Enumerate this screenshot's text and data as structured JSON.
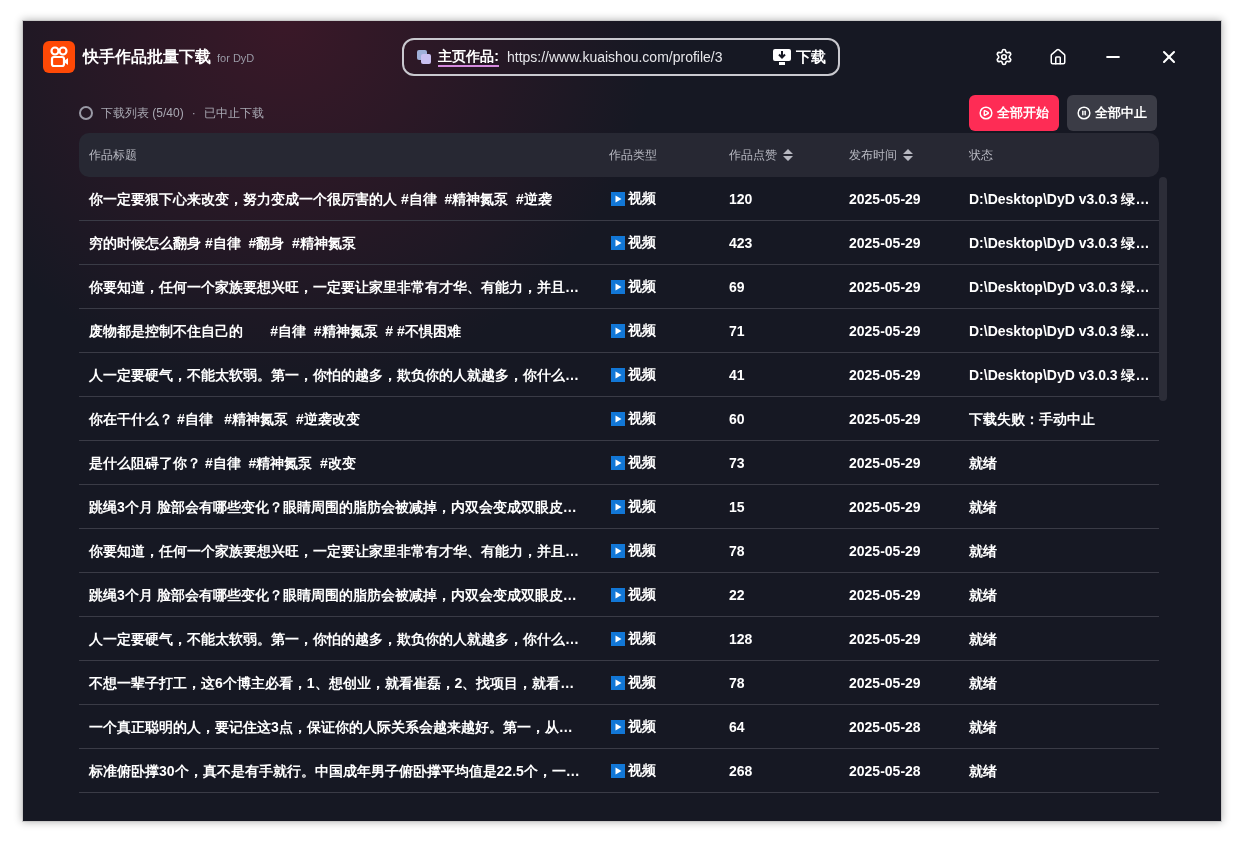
{
  "app": {
    "title": "快手作品批量下载",
    "subtitle": "for DyD"
  },
  "url_bar": {
    "label": "主页作品:",
    "value": "https://www.kuaishou.com/profile/3",
    "button": "下载"
  },
  "list_status": {
    "count": "下载列表 (5/40)",
    "separator": "·",
    "state": "已中止下载"
  },
  "actions": [
    {
      "label": "全部开始",
      "kind": "start"
    },
    {
      "label": "全部中止",
      "kind": "stop"
    }
  ],
  "table": {
    "columns": [
      {
        "label": "作品标题",
        "sortable": false
      },
      {
        "label": "作品类型",
        "sortable": false
      },
      {
        "label": "作品点赞",
        "sortable": true
      },
      {
        "label": "发布时间",
        "sortable": true
      },
      {
        "label": "状态",
        "sortable": false
      }
    ],
    "rows": [
      {
        "title": "你一定要狠下心来改变，努力变成一个很厉害的人 #自律  #精神氮泵  #逆袭",
        "type": "视频",
        "likes": "120",
        "date": "2025-05-29",
        "status": "D:\\Desktop\\DyD v3.0.3 绿…"
      },
      {
        "title": "穷的时候怎么翻身 #自律  #翻身  #精神氮泵",
        "type": "视频",
        "likes": "423",
        "date": "2025-05-29",
        "status": "D:\\Desktop\\DyD v3.0.3 绿…"
      },
      {
        "title": "你要知道，任何一个家族要想兴旺，一定要让家里非常有才华、有能力，并且…",
        "type": "视频",
        "likes": "69",
        "date": "2025-05-29",
        "status": "D:\\Desktop\\DyD v3.0.3 绿…"
      },
      {
        "title": "废物都是控制不住自己的       #自律  #精神氮泵  # #不惧困难",
        "type": "视频",
        "likes": "71",
        "date": "2025-05-29",
        "status": "D:\\Desktop\\DyD v3.0.3 绿…"
      },
      {
        "title": "人一定要硬气，不能太软弱。第一，你怕的越多，欺负你的人就越多，你什么…",
        "type": "视频",
        "likes": "41",
        "date": "2025-05-29",
        "status": "D:\\Desktop\\DyD v3.0.3 绿…"
      },
      {
        "title": "你在干什么？ #自律   #精神氮泵  #逆袭改变",
        "type": "视频",
        "likes": "60",
        "date": "2025-05-29",
        "status": "下载失败：手动中止"
      },
      {
        "title": "是什么阻碍了你？ #自律  #精神氮泵  #改变",
        "type": "视频",
        "likes": "73",
        "date": "2025-05-29",
        "status": "就绪"
      },
      {
        "title": "跳绳3个月 脸部会有哪些变化？眼睛周围的脂肪会被减掉，内双会变成双眼皮…",
        "type": "视频",
        "likes": "15",
        "date": "2025-05-29",
        "status": "就绪"
      },
      {
        "title": "你要知道，任何一个家族要想兴旺，一定要让家里非常有才华、有能力，并且…",
        "type": "视频",
        "likes": "78",
        "date": "2025-05-29",
        "status": "就绪"
      },
      {
        "title": "跳绳3个月 脸部会有哪些变化？眼睛周围的脂肪会被减掉，内双会变成双眼皮…",
        "type": "视频",
        "likes": "22",
        "date": "2025-05-29",
        "status": "就绪"
      },
      {
        "title": "人一定要硬气，不能太软弱。第一，你怕的越多，欺负你的人就越多，你什么…",
        "type": "视频",
        "likes": "128",
        "date": "2025-05-29",
        "status": "就绪"
      },
      {
        "title": "不想一辈子打工，这6个博主必看，1、想创业，就看崔磊，2、找项目，就看…",
        "type": "视频",
        "likes": "78",
        "date": "2025-05-29",
        "status": "就绪"
      },
      {
        "title": "一个真正聪明的人，要记住这3点，保证你的人际关系会越来越好。第一，从…",
        "type": "视频",
        "likes": "64",
        "date": "2025-05-28",
        "status": "就绪"
      },
      {
        "title": "标准俯卧撑30个，真不是有手就行。中国成年男子俯卧撑平均值是22.5个，一…",
        "type": "视频",
        "likes": "268",
        "date": "2025-05-28",
        "status": "就绪"
      }
    ]
  }
}
